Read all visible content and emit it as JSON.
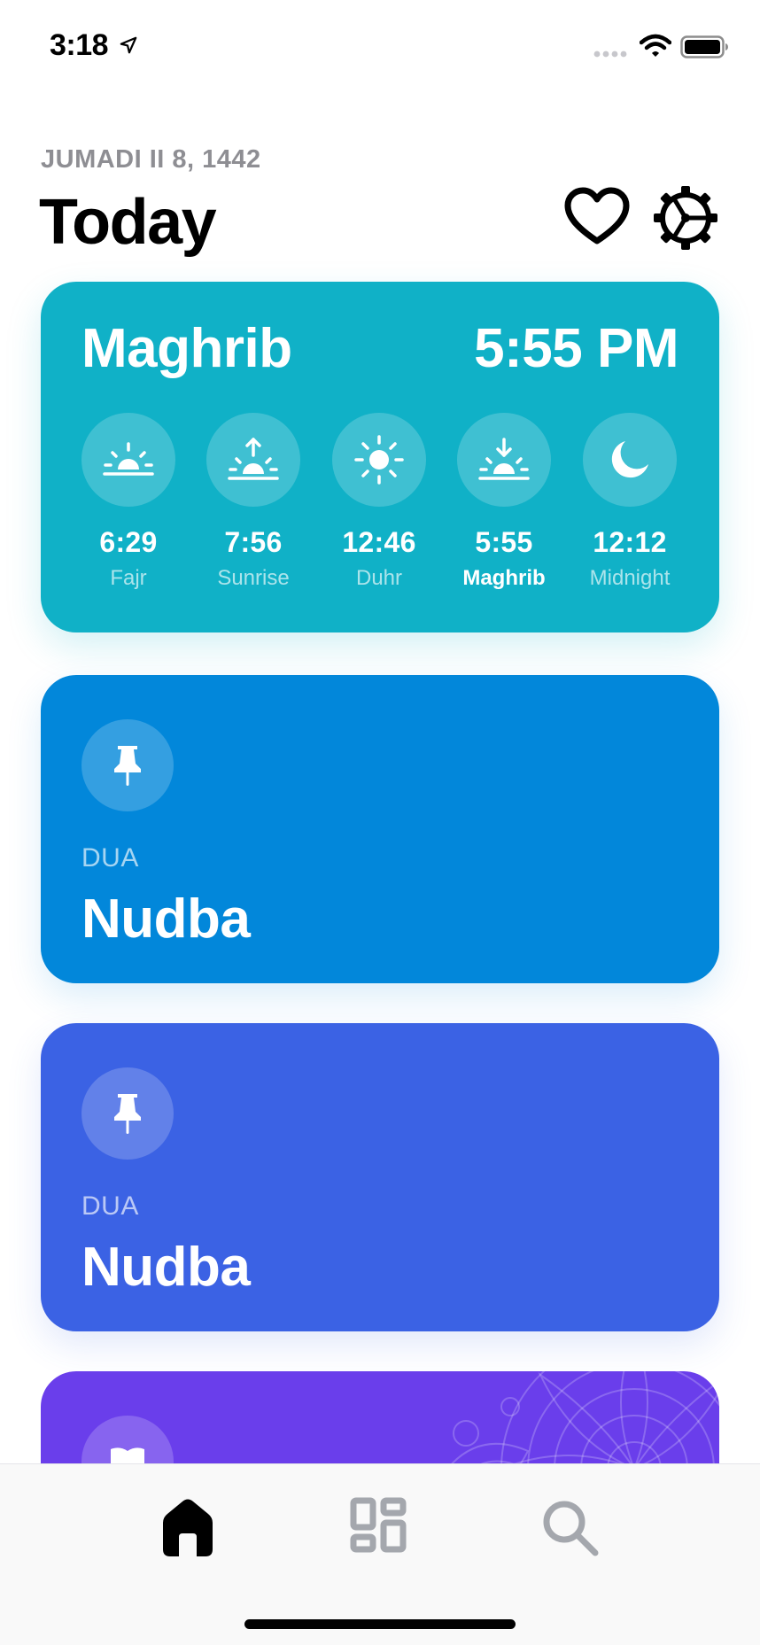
{
  "status_bar": {
    "time": "3:18"
  },
  "header": {
    "date": "JUMADI II 8, 1442",
    "title": "Today"
  },
  "prayer_card": {
    "current_name": "Maghrib",
    "current_time": "5:55 PM",
    "times": [
      {
        "time": "6:29",
        "name": "Fajr",
        "icon": "sunrise-horizon-icon"
      },
      {
        "time": "7:56",
        "name": "Sunrise",
        "icon": "sunrise-arrow-icon"
      },
      {
        "time": "12:46",
        "name": "Duhr",
        "icon": "sun-icon"
      },
      {
        "time": "5:55",
        "name": "Maghrib",
        "icon": "sunset-arrow-icon"
      },
      {
        "time": "12:12",
        "name": "Midnight",
        "icon": "moon-icon"
      }
    ]
  },
  "cards": [
    {
      "category": "DUA",
      "title": "Nudba",
      "color": "#0287da",
      "icon": "pin-icon"
    },
    {
      "category": "DUA",
      "title": "Nudba",
      "color": "#3b62e4",
      "icon": "pin-icon"
    }
  ],
  "feature_card": {
    "color": "#6a3eeb",
    "icon": "book-icon"
  },
  "tabs": [
    {
      "name": "home",
      "icon": "home-icon",
      "active": true
    },
    {
      "name": "library",
      "icon": "grid-icon",
      "active": false
    },
    {
      "name": "search",
      "icon": "search-icon",
      "active": false
    }
  ],
  "colors": {
    "prayer_card": "#10b1c7",
    "tab_active": "#000000",
    "tab_inactive": "#a4a7ad"
  }
}
